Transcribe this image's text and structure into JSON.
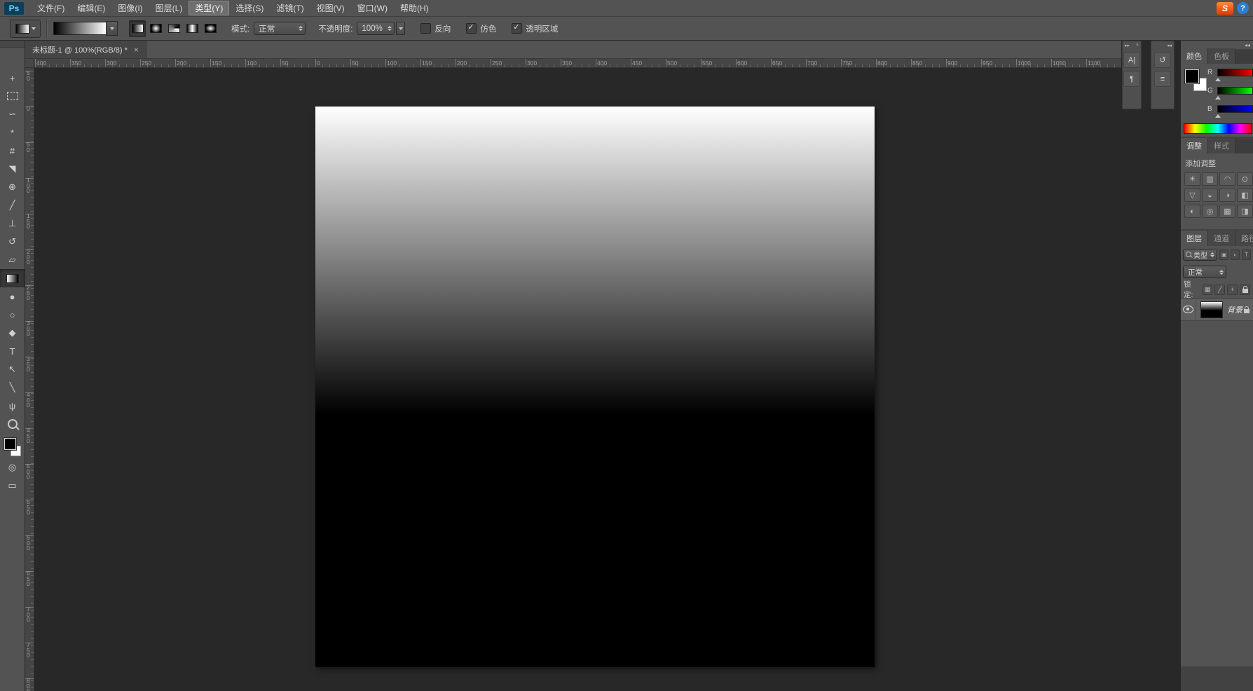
{
  "menu_bar": {
    "logo": "Ps",
    "items": [
      {
        "label": "文件(F)",
        "active": false
      },
      {
        "label": "编辑(E)",
        "active": false
      },
      {
        "label": "图像(I)",
        "active": false
      },
      {
        "label": "图层(L)",
        "active": false
      },
      {
        "label": "类型(Y)",
        "active": true
      },
      {
        "label": "选择(S)",
        "active": false
      },
      {
        "label": "滤镜(T)",
        "active": false
      },
      {
        "label": "视图(V)",
        "active": false
      },
      {
        "label": "窗口(W)",
        "active": false
      },
      {
        "label": "帮助(H)",
        "active": false
      }
    ],
    "tray": [
      {
        "name": "sogou-input",
        "label": "S"
      },
      {
        "name": "help",
        "label": "?"
      }
    ]
  },
  "options_bar": {
    "mode_label": "模式:",
    "mode_value": "正常",
    "opacity_label": "不透明度:",
    "opacity_value": "100%",
    "gradient_types": [
      "linear",
      "radial",
      "angle",
      "reflected",
      "diamond"
    ],
    "selected_gradient_type": "linear",
    "checkboxes": [
      {
        "key": "reverse",
        "label": "反向",
        "checked": false
      },
      {
        "key": "dither",
        "label": "仿色",
        "checked": true
      },
      {
        "key": "transparency",
        "label": "透明区域",
        "checked": true
      }
    ]
  },
  "tools": [
    {
      "name": "move",
      "glyph": "+"
    },
    {
      "name": "rectangular-marquee",
      "glyph": ""
    },
    {
      "name": "lasso",
      "glyph": "∽"
    },
    {
      "name": "magic-wand",
      "glyph": "*"
    },
    {
      "name": "crop",
      "glyph": "#"
    },
    {
      "name": "eyedropper",
      "glyph": "◥"
    },
    {
      "name": "healing-brush",
      "glyph": "⊕"
    },
    {
      "name": "brush",
      "glyph": "╱"
    },
    {
      "name": "clone-stamp",
      "glyph": "⊥"
    },
    {
      "name": "history-brush",
      "glyph": "↺"
    },
    {
      "name": "eraser",
      "glyph": "▱"
    },
    {
      "name": "gradient",
      "glyph": "",
      "selected": true
    },
    {
      "name": "blur",
      "glyph": "●"
    },
    {
      "name": "dodge",
      "glyph": "○"
    },
    {
      "name": "pen",
      "glyph": "◆"
    },
    {
      "name": "type",
      "glyph": "T"
    },
    {
      "name": "path-selection",
      "glyph": "↖"
    },
    {
      "name": "line-shape",
      "glyph": "╲"
    },
    {
      "name": "hand",
      "glyph": "ψ"
    },
    {
      "name": "zoom",
      "glyph": ""
    },
    {
      "name": "foreground-background-colors",
      "glyph": ""
    },
    {
      "name": "quick-mask",
      "glyph": "◎"
    },
    {
      "name": "screen-mode",
      "glyph": "▭"
    }
  ],
  "document": {
    "tab_title": "未标题-1 @ 100%(RGB/8) *",
    "close": "×",
    "canvas_gradient": {
      "from": "#ffffff",
      "to": "#000000",
      "black_point": "55%"
    }
  },
  "rulers": {
    "horizontal_labels": [
      "400",
      "350",
      "300",
      "250",
      "200",
      "150",
      "100",
      "50",
      "0",
      "50",
      "100",
      "150",
      "200",
      "250",
      "300",
      "350",
      "400",
      "450",
      "500",
      "550",
      "600",
      "650",
      "700",
      "750",
      "800",
      "850",
      "900",
      "950",
      "1000",
      "1050",
      "1100"
    ],
    "vertical_labels": [
      "50",
      "0",
      "50",
      "100",
      "150",
      "200",
      "250",
      "300",
      "350",
      "400",
      "450",
      "500",
      "550",
      "600",
      "650",
      "700",
      "750",
      "800"
    ]
  },
  "collapsed_docks": {
    "group1": {
      "collapse_icon": "▸▸",
      "close_icon": "×",
      "buttons": [
        {
          "name": "character-panel",
          "label": "A|"
        },
        {
          "name": "paragraph-panel",
          "label": "¶"
        }
      ]
    },
    "group2": {
      "collapse_icon": "◂◂",
      "buttons": [
        {
          "name": "history-panel",
          "label": "↺"
        },
        {
          "name": "properties-panel",
          "label": "≡"
        }
      ]
    }
  },
  "dock": {
    "collapse_icon": "◂◂",
    "color_panel": {
      "tabs": [
        {
          "label": "颜色",
          "active": true
        },
        {
          "label": "色板",
          "active": false
        }
      ],
      "sliders": [
        {
          "label": "R",
          "value": 0
        },
        {
          "label": "G",
          "value": 0
        },
        {
          "label": "B",
          "value": 0
        }
      ],
      "foreground_color": "#000000",
      "background_color": "#ffffff"
    },
    "adjustments_panel": {
      "tabs": [
        {
          "label": "调整",
          "active": true
        },
        {
          "label": "样式",
          "active": false
        }
      ],
      "title": "添加调整",
      "icons": [
        {
          "name": "brightness-contrast-icon",
          "glyph": "☀"
        },
        {
          "name": "levels-icon",
          "glyph": "▥"
        },
        {
          "name": "curves-icon",
          "glyph": "◠"
        },
        {
          "name": "exposure-icon",
          "glyph": "⊙"
        },
        {
          "name": "vibrance-icon",
          "glyph": "▽"
        },
        {
          "name": "hue-saturation-icon",
          "glyph": "◒"
        },
        {
          "name": "color-balance-icon",
          "glyph": "◑"
        },
        {
          "name": "black-white-icon",
          "glyph": "◧"
        },
        {
          "name": "photo-filter-icon",
          "glyph": "◐"
        },
        {
          "name": "channel-mixer-icon",
          "glyph": "◎"
        },
        {
          "name": "color-lookup-icon",
          "glyph": "▦"
        },
        {
          "name": "invert-icon",
          "glyph": "◨"
        }
      ]
    },
    "layers_panel": {
      "tabs": [
        {
          "label": "图层",
          "active": true
        },
        {
          "label": "通道",
          "active": false
        },
        {
          "label": "路径",
          "active": false
        }
      ],
      "filter_label": "类型",
      "filter_icons": [
        {
          "name": "filter-pixel-layers-icon",
          "glyph": "▣"
        },
        {
          "name": "filter-adjustment-layers-icon",
          "glyph": "◐"
        },
        {
          "name": "filter-type-layers-icon",
          "glyph": "T"
        }
      ],
      "blend_mode": "正常",
      "lock_label": "锁定:",
      "lock_icons": [
        {
          "name": "lock-transparency-icon",
          "glyph": "▦"
        },
        {
          "name": "lock-paint-icon",
          "glyph": "╱"
        },
        {
          "name": "lock-position-icon",
          "glyph": "+"
        },
        {
          "name": "lock-all-icon",
          "glyph": ""
        }
      ],
      "layers": [
        {
          "name": "背景",
          "visible": true,
          "locked": true,
          "selected": true
        }
      ]
    }
  }
}
